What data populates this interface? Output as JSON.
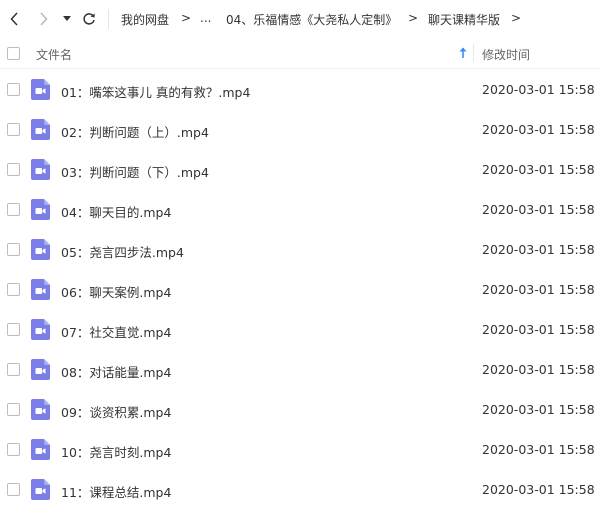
{
  "breadcrumb": {
    "items": [
      {
        "label": "我的网盘"
      },
      {
        "label": "..."
      },
      {
        "label": "04、乐福情感《大尧私人定制》"
      },
      {
        "label": "聊天课精华版"
      }
    ],
    "separator": ">"
  },
  "header": {
    "name_label": "文件名",
    "time_label": "修改时间",
    "sort_direction": "ascending"
  },
  "files": [
    {
      "name": "01：嘴笨这事儿 真的有救？.mp4",
      "modified": "2020-03-01 15:58"
    },
    {
      "name": "02：判断问题（上）.mp4",
      "modified": "2020-03-01 15:58"
    },
    {
      "name": "03：判断问题（下）.mp4",
      "modified": "2020-03-01 15:58"
    },
    {
      "name": "04：聊天目的.mp4",
      "modified": "2020-03-01 15:58"
    },
    {
      "name": "05：尧言四步法.mp4",
      "modified": "2020-03-01 15:58"
    },
    {
      "name": "06：聊天案例.mp4",
      "modified": "2020-03-01 15:58"
    },
    {
      "name": "07：社交直觉.mp4",
      "modified": "2020-03-01 15:58"
    },
    {
      "name": "08：对话能量.mp4",
      "modified": "2020-03-01 15:58"
    },
    {
      "name": "09：谈资积累.mp4",
      "modified": "2020-03-01 15:58"
    },
    {
      "name": "10：尧言时刻.mp4",
      "modified": "2020-03-01 15:58"
    },
    {
      "name": "11：课程总结.mp4",
      "modified": "2020-03-01 15:58"
    }
  ],
  "icons": {
    "back": "chevron-left-icon",
    "forward": "chevron-right-icon",
    "history": "caret-down-icon",
    "refresh": "refresh-icon",
    "file": "video-file-icon",
    "sort": "sort-arrow-up-icon"
  },
  "colors": {
    "video_icon": "#7b7ee6",
    "sort_arrow": "#3b8ef0",
    "text": "#333333",
    "muted_text": "#666666",
    "checkbox_border": "#bdbdbd"
  }
}
